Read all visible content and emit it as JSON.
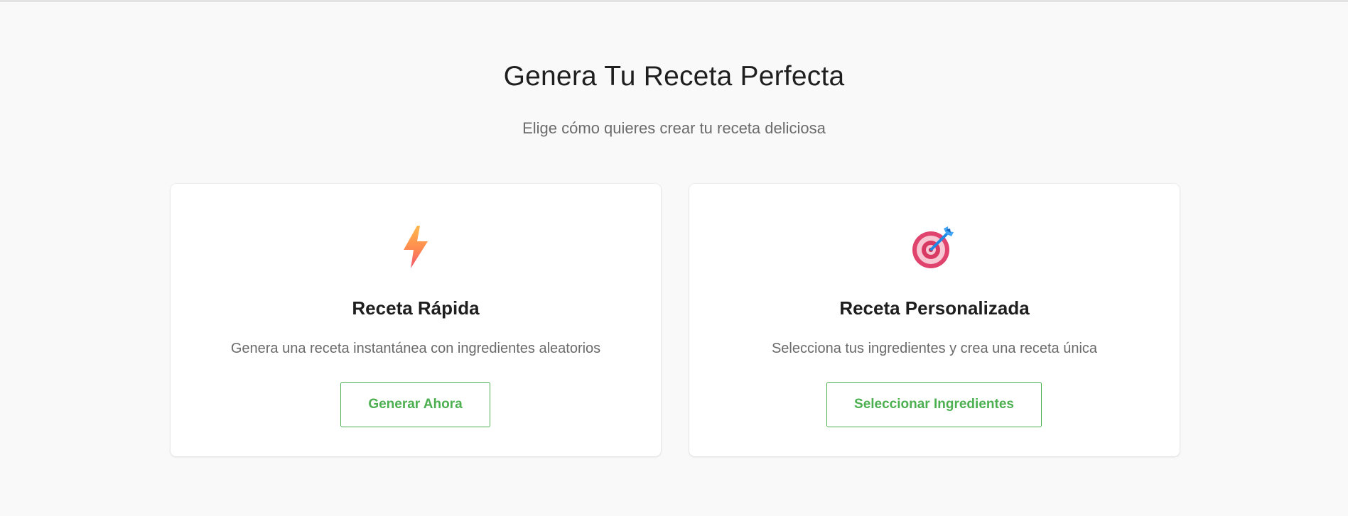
{
  "header": {
    "title": "Genera Tu Receta Perfecta",
    "subtitle": "Elige cómo quieres crear tu receta deliciosa"
  },
  "cards": [
    {
      "icon": "lightning-bolt-icon",
      "title": "Receta Rápida",
      "description": "Genera una receta instantánea con ingredientes aleatorios",
      "button_label": "Generar Ahora"
    },
    {
      "icon": "target-dart-icon",
      "title": "Receta Personalizada",
      "description": "Selecciona tus ingredientes y crea una receta única",
      "button_label": "Seleccionar Ingredientes"
    }
  ],
  "colors": {
    "accent": "#4caf50",
    "background": "#f9f9f9",
    "card": "#ffffff",
    "text": "#1f1f1f",
    "muted": "#6b6b6b"
  }
}
